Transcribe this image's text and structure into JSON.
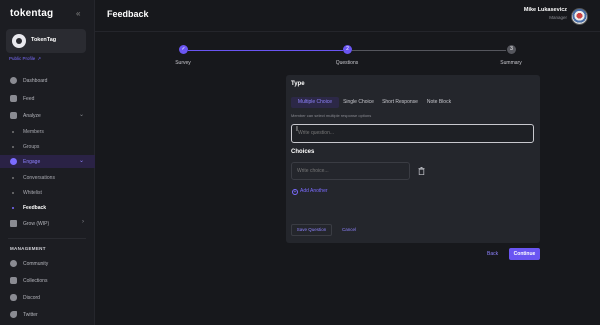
{
  "app": {
    "logo_text": "tokentag"
  },
  "org": {
    "name": "TokenTag",
    "public_profile_label": "Public Profile"
  },
  "sidebar": {
    "items": [
      {
        "label": "Dashboard"
      },
      {
        "label": "Feed"
      },
      {
        "label": "Analyze"
      },
      {
        "label": "Members"
      },
      {
        "label": "Groups"
      },
      {
        "label": "Engage"
      },
      {
        "label": "Conversations"
      },
      {
        "label": "Whitelist"
      },
      {
        "label": "Feedback"
      },
      {
        "label": "Grow (WIP)"
      }
    ],
    "management_title": "MANAGEMENT",
    "management_items": [
      {
        "label": "Community"
      },
      {
        "label": "Collections"
      },
      {
        "label": "Discord"
      },
      {
        "label": "Twitter"
      }
    ]
  },
  "header": {
    "title": "Feedback",
    "user_name": "Mike Lukasevicz",
    "user_role": "Manager"
  },
  "stepper": {
    "steps": [
      {
        "label": "Survey",
        "marker": "✓",
        "state": "done"
      },
      {
        "label": "Questions",
        "marker": "2",
        "state": "current"
      },
      {
        "label": "Summary",
        "marker": "3",
        "state": "upcoming"
      }
    ],
    "colors": {
      "active": "#6a55f2",
      "inactive": "#55565d"
    }
  },
  "form": {
    "type_title": "Type",
    "tabs": [
      {
        "label": "Multiple Choice",
        "active": true
      },
      {
        "label": "Single Choice",
        "active": false
      },
      {
        "label": "Short Response",
        "active": false
      },
      {
        "label": "Note Block",
        "active": false
      }
    ],
    "helper_text": "Member can select multiple response options",
    "question_placeholder": "Write question...",
    "choices_title": "Choices",
    "choice_placeholder": "Write choice...",
    "add_another_label": "Add Another",
    "save_label": "Save Question",
    "cancel_label": "Cancel"
  },
  "footer": {
    "back_label": "Back",
    "continue_label": "Continue"
  },
  "colors": {
    "accent": "#6a55f2",
    "background": "#17181c",
    "card": "#24262c"
  }
}
